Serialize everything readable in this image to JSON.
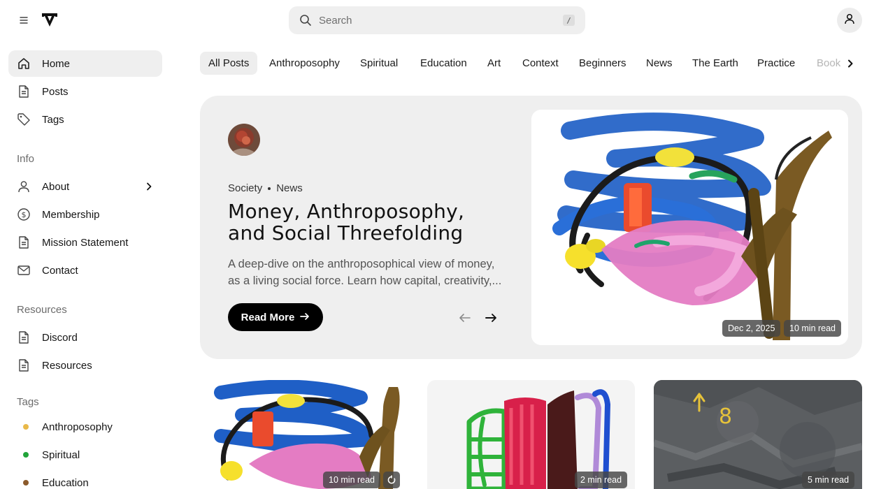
{
  "search": {
    "placeholder": "Search",
    "shortcut": "/"
  },
  "sidebar": {
    "main": [
      {
        "label": "Home",
        "icon": "home-icon",
        "active": true
      },
      {
        "label": "Posts",
        "icon": "document-icon"
      },
      {
        "label": "Tags",
        "icon": "tag-icon"
      }
    ],
    "info_title": "Info",
    "info": [
      {
        "label": "About",
        "icon": "user-icon"
      },
      {
        "label": "Membership",
        "icon": "dollar-icon"
      },
      {
        "label": "Mission Statement",
        "icon": "document-icon"
      },
      {
        "label": "Contact",
        "icon": "mail-icon"
      }
    ],
    "resources_title": "Resources",
    "resources": [
      {
        "label": "Discord",
        "icon": "document-icon"
      },
      {
        "label": "Resources",
        "icon": "document-icon"
      }
    ],
    "tags_title": "Tags",
    "tags": [
      {
        "label": "Anthroposophy",
        "color": "#e9b949"
      },
      {
        "label": "Spiritual",
        "color": "#22a43a"
      },
      {
        "label": "Education",
        "color": "#8b5a2b"
      }
    ]
  },
  "tabs": [
    "All Posts",
    "Anthroposophy",
    "Spiritual",
    "Education",
    "Art",
    "Context",
    "Beginners",
    "News",
    "The Earth",
    "Practice",
    "Book"
  ],
  "hero": {
    "categories": [
      "Society",
      "News"
    ],
    "title": "Money, Anthroposophy, and Social Threefolding",
    "excerpt_lines": [
      "A deep-dive on the anthroposophical view of money,",
      "as a living social force. Learn how capital, creativity,..."
    ],
    "read_more": "Read More",
    "date": "Dec 2, 2025",
    "read_time": "10 min read"
  },
  "cards": [
    {
      "read_time": "10 min read",
      "extra_icon": "refresh-icon"
    },
    {
      "read_time": "2 min read"
    },
    {
      "read_time": "5 min read"
    }
  ],
  "colors": {
    "accent": "#000000",
    "panel": "#efefef",
    "active_nav": "#efefef"
  }
}
